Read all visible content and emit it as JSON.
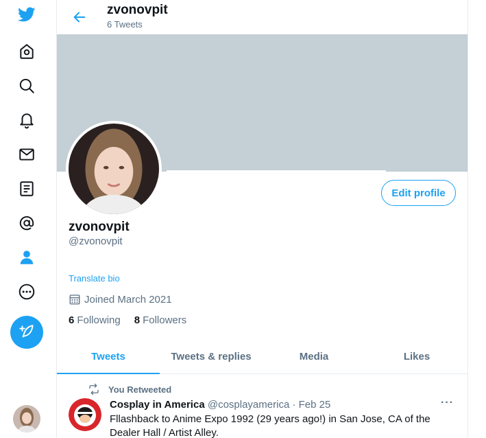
{
  "sidebar": {
    "icons": [
      "twitter-logo-icon",
      "home-icon",
      "explore-search-icon",
      "notifications-bell-icon",
      "messages-mail-icon",
      "lists-icon",
      "mentions-at-icon",
      "profile-person-icon",
      "more-icon",
      "compose-tweet-icon"
    ],
    "accent": "#1da1f2"
  },
  "header": {
    "title": "zvonovpit",
    "subtitle": "6 Tweets"
  },
  "profile": {
    "edit_label": "Edit profile",
    "name": "zvonovpit",
    "handle": "@zvonovpit",
    "translate_label": "Translate bio",
    "joined": "Joined March 2021",
    "following_count": "6",
    "following_label": "Following",
    "followers_count": "8",
    "followers_label": "Followers",
    "banner_color": "#c4cfd6"
  },
  "tabs": [
    {
      "label": "Tweets"
    },
    {
      "label": "Tweets & replies"
    },
    {
      "label": "Media"
    },
    {
      "label": "Likes"
    }
  ],
  "tweet": {
    "retweet_label": "You Retweeted",
    "author": "Cosplay in America",
    "handle": "@cosplayamerica",
    "separator": "·",
    "date": "Feb 25",
    "text": "Fllashback to Anime Expo 1992 (29 years ago!) in San Jose, CA of the Dealer Hall / Artist Alley.",
    "more": "···"
  }
}
